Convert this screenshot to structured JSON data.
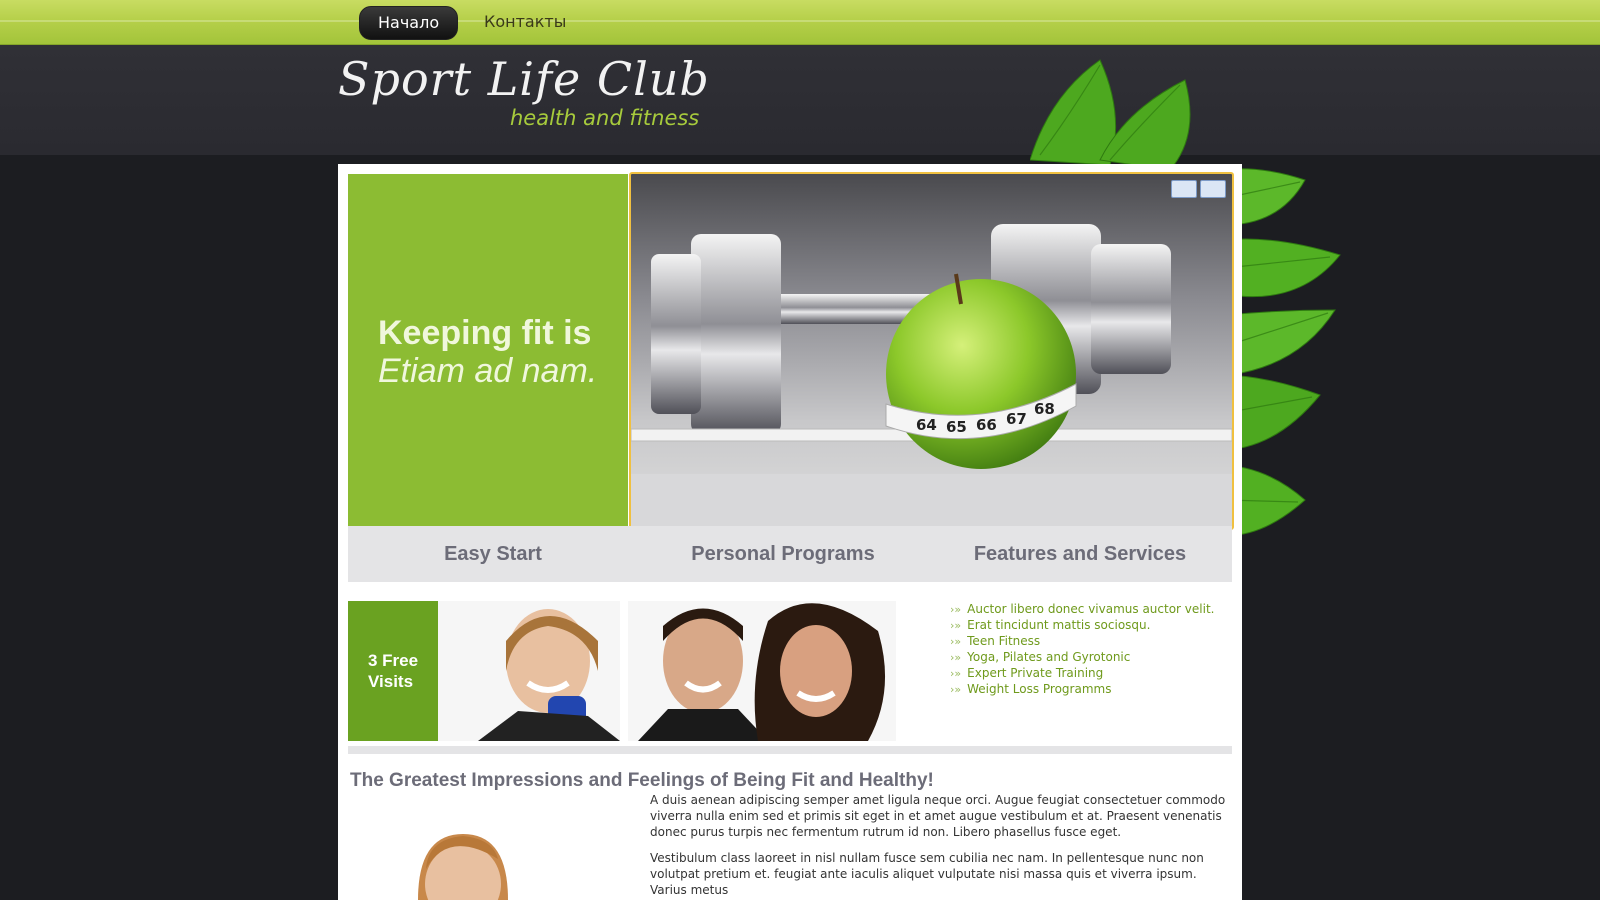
{
  "nav": {
    "items": [
      {
        "label": "Начало",
        "active": true
      },
      {
        "label": "Контакты",
        "active": false
      }
    ]
  },
  "header": {
    "title": "Sport Life Club",
    "subtitle": "health and fitness"
  },
  "hero": {
    "line1": "Keeping fit is",
    "line2": "Etiam ad nam."
  },
  "tabs": [
    "Easy Start",
    "Personal Programs",
    "Features and Services"
  ],
  "promo": {
    "line1": "3 Free",
    "line2": "Visits"
  },
  "features": [
    "Auctor libero donec vivamus auctor velit.",
    "Erat tincidunt mattis sociosqu.",
    "Teen Fitness",
    "Yoga, Pilates and Gyrotonic",
    "Expert Private Training",
    "Weight Loss Programms"
  ],
  "article": {
    "title": "The Greatest Impressions and Feelings of Being Fit and Healthy!",
    "paragraphs": [
      "A duis aenean adipiscing semper amet ligula neque orci. Augue feugiat consectetuer commodo viverra nulla enim sed et primis sit eget in et amet augue vestibulum et at. Praesent venenatis donec purus turpis nec fermentum rutrum id non. Libero phasellus fusce eget.",
      "Vestibulum class laoreet in nisl nullam fusce sem cubilia nec nam. In pellentesque nunc non volutpat pretium et. feugiat ante iaculis aliquet vulputate nisi massa quis et viverra ipsum. Varius metus"
    ]
  },
  "colors": {
    "accent_green": "#8cbc33",
    "link_green": "#6f9a1c",
    "background_dark": "#1c1d21",
    "highlight_border": "#f0c040"
  }
}
